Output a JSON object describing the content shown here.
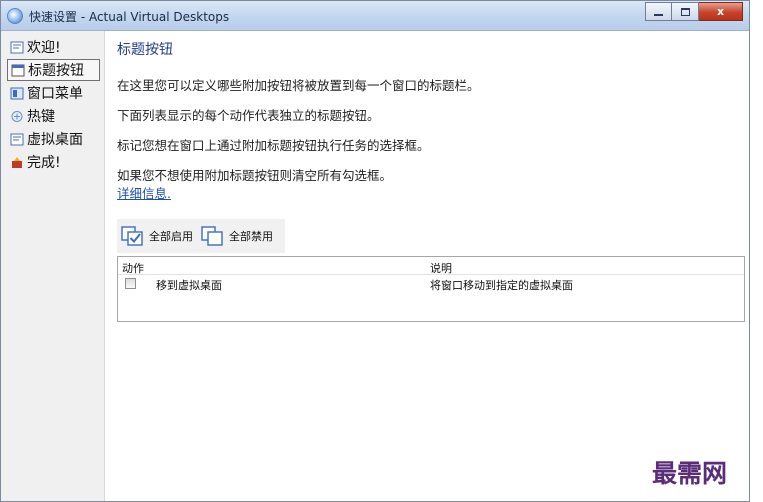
{
  "window": {
    "title": "快速设置 - Actual Virtual Desktops",
    "buttons": {
      "close": "x"
    }
  },
  "sidebar": {
    "items": [
      {
        "label": "欢迎!",
        "icon": "page-icon",
        "active": false
      },
      {
        "label": "标题按钮",
        "icon": "title-bar-icon",
        "active": true
      },
      {
        "label": "窗口菜单",
        "icon": "window-menu-icon",
        "active": false
      },
      {
        "label": "热键",
        "icon": "hotkey-icon",
        "active": false
      },
      {
        "label": "虚拟桌面",
        "icon": "virtual-desktop-icon",
        "active": false
      },
      {
        "label": "完成!",
        "icon": "finish-icon",
        "active": false
      }
    ]
  },
  "main": {
    "heading": "标题按钮",
    "paragraphs": [
      "在这里您可以定义哪些附加按钮将被放置到每一个窗口的标题栏。",
      "下面列表显示的每个动作代表独立的标题按钮。",
      "标记您想在窗口上通过附加标题按钮执行任务的选择框。",
      "如果您不想使用附加标题按钮则清空所有勾选框。"
    ],
    "more_link": "详细信息."
  },
  "toolbar": {
    "enable_all": "全部启用",
    "disable_all": "全部禁用"
  },
  "list": {
    "columns": [
      "动作",
      "说明"
    ],
    "rows": [
      {
        "action": "移到虚拟桌面",
        "description": "将窗口移动到指定的虚拟桌面",
        "checked": false
      }
    ]
  },
  "watermark": "最需网",
  "colors": {
    "heading": "#1f3c8f",
    "link": "#1b4fb4",
    "watermark": "#5a2c7a"
  }
}
